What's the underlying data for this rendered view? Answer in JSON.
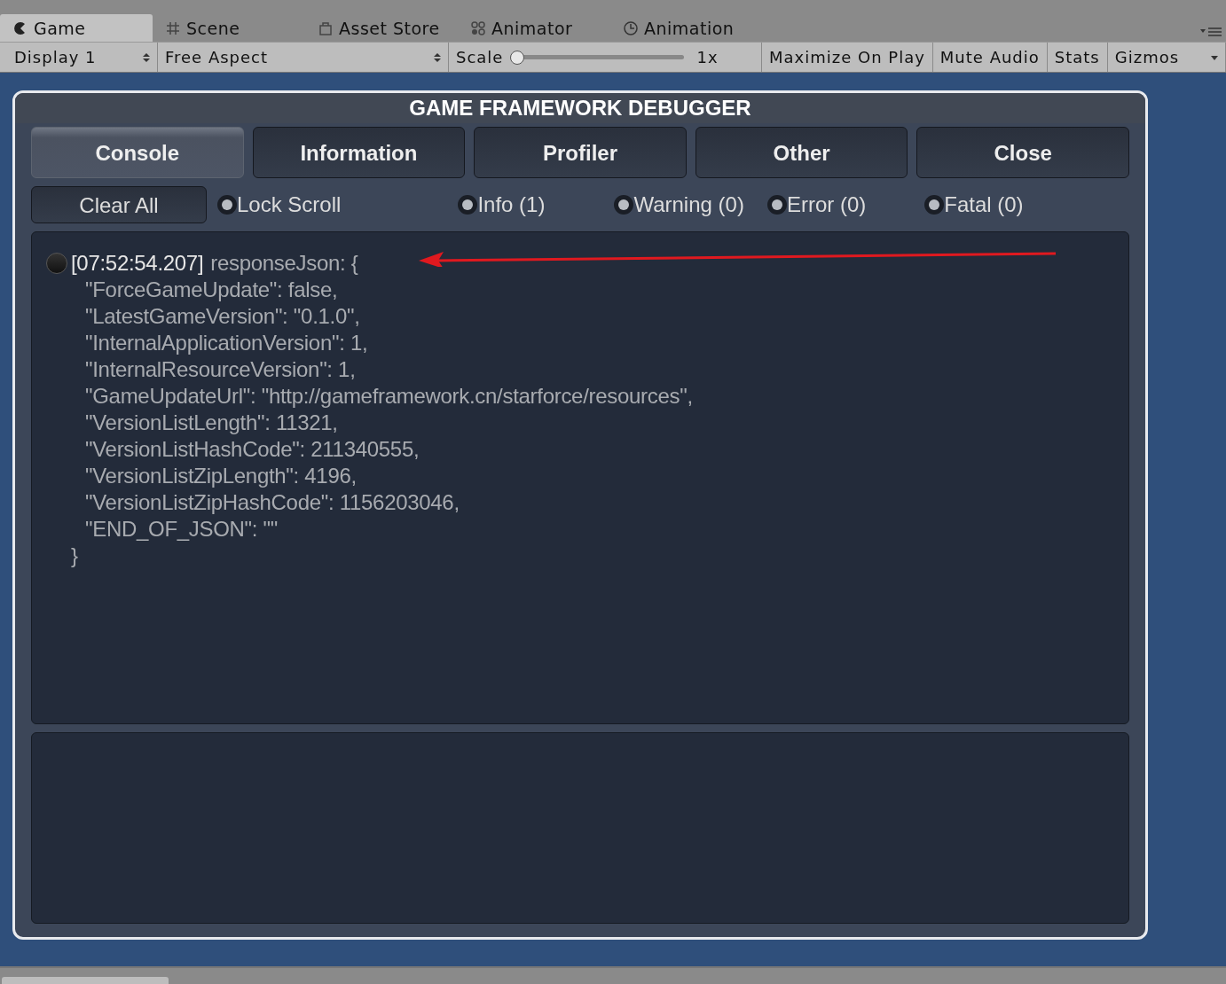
{
  "editor_tabs": [
    {
      "label": "Game",
      "selected": true
    },
    {
      "label": "Scene",
      "selected": false
    },
    {
      "label": "Asset Store",
      "selected": false
    },
    {
      "label": "Animator",
      "selected": false
    },
    {
      "label": "Animation",
      "selected": false
    }
  ],
  "toolbar": {
    "display": "Display 1",
    "aspect": "Free Aspect",
    "scale_label": "Scale",
    "scale": {
      "level": 0.0
    },
    "scale_reading": "1x",
    "toggles": [
      {
        "label": "Maximize On Play",
        "on": false
      },
      {
        "label": "Mute Audio",
        "on": false
      },
      {
        "label": "Stats",
        "on": false
      }
    ],
    "gizmos": "Gizmos"
  },
  "debugger": {
    "title": "GAME FRAMEWORK DEBUGGER",
    "tabs": [
      {
        "label": "Console",
        "selected": true
      },
      {
        "label": "Information",
        "selected": false
      },
      {
        "label": "Profiler",
        "selected": false
      },
      {
        "label": "Other",
        "selected": false
      },
      {
        "label": "Close",
        "selected": false
      }
    ],
    "clear_button": "Clear All",
    "filters": [
      {
        "label": "Lock Scroll",
        "checked": true
      },
      {
        "label": "Info (1)",
        "checked": true
      },
      {
        "label": "Warning (0)",
        "checked": true
      },
      {
        "label": "Error (0)",
        "checked": true
      },
      {
        "label": "Fatal (0)",
        "checked": true
      }
    ],
    "log": [
      {
        "selected": false,
        "time": "[07:52:54.207]",
        "message": "responseJson:  {",
        "lines": [
          "\"ForceGameUpdate\": false,",
          "\"LatestGameVersion\": \"0.1.0\",",
          "\"InternalApplicationVersion\": 1,",
          "\"InternalResourceVersion\": 1,",
          "\"GameUpdateUrl\": \"http://gameframework.cn/starforce/resources\",",
          "\"VersionListLength\": 11321,",
          "\"VersionListHashCode\": 211340555,",
          "\"VersionListZipLength\": 4196,",
          "\"VersionListZipHashCode\": 1156203046,",
          "\"END_OF_JSON\": \"\""
        ],
        "closing": "}"
      }
    ]
  }
}
